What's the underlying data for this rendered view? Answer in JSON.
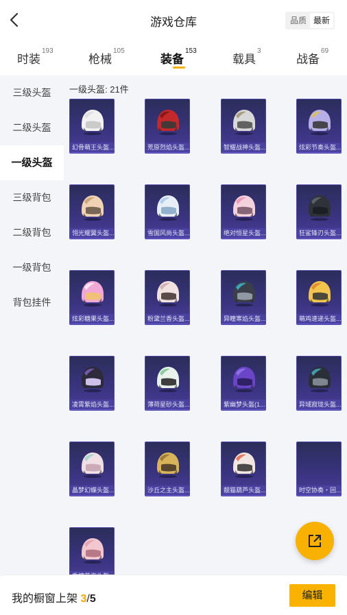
{
  "header": {
    "title": "游戏仓库",
    "sort_options": [
      "品质",
      "最新"
    ],
    "active_sort": 1
  },
  "tabs": [
    {
      "label": "时装",
      "count": "193"
    },
    {
      "label": "枪械",
      "count": "105"
    },
    {
      "label": "装备",
      "count": "153"
    },
    {
      "label": "载具",
      "count": "3"
    },
    {
      "label": "战备",
      "count": "69"
    }
  ],
  "active_tab": 2,
  "sidebar": {
    "items": [
      "三级头盔",
      "二级头盔",
      "一级头盔",
      "三级背包",
      "二级背包",
      "一级背包",
      "背包挂件"
    ],
    "active": 2
  },
  "section": {
    "title": "一级头盔: 21件"
  },
  "items": [
    {
      "name": "幻骨萌王头盔...",
      "base": "#f2f2f2",
      "accent": "#d9d9d9",
      "visor": "#c7c7c7"
    },
    {
      "name": "荒原烈焰头盔...",
      "base": "#c3292b",
      "accent": "#7a1212",
      "visor": "#3a3a3a"
    },
    {
      "name": "智耀战神头盔...",
      "base": "#d8d8d8",
      "accent": "#9a8a6a",
      "visor": "#555555"
    },
    {
      "name": "炫彩节奏头盔...",
      "base": "#b7b0e8",
      "accent": "#e0c341",
      "visor": "#3a3a3a"
    },
    {
      "name": "翎光耀翼头盔...",
      "base": "#f0d3b5",
      "accent": "#c19a6b",
      "visor": "#6b5a4a"
    },
    {
      "name": "雪国风尚头盔...",
      "base": "#e8eef5",
      "accent": "#9fc3e8",
      "visor": "#8aaac8"
    },
    {
      "name": "绝对恒星头盔...",
      "base": "#f3d1dd",
      "accent": "#e58bb0",
      "visor": "#7a5a6a"
    },
    {
      "name": "狂鲨锋刃头盔...",
      "base": "#2f3238",
      "accent": "#6a6f78",
      "visor": "#1b1d21"
    },
    {
      "name": "炫彩糖果头盔...",
      "base": "#f2a8d6",
      "accent": "#ffffff",
      "visor": "#f0c36b"
    },
    {
      "name": "粉黛兰香头盔...",
      "base": "#f1e1e1",
      "accent": "#c9a3a3",
      "visor": "#4a3a3a"
    },
    {
      "name": "异瞳寒焰头盔...",
      "base": "#3a3f4a",
      "accent": "#3ec7e0",
      "visor": "#9aa2ad"
    },
    {
      "name": "萌鸡速递头盔...",
      "base": "#f2c54d",
      "accent": "#e07a2a",
      "visor": "#3a3a3a"
    },
    {
      "name": "凌霄紫焰头盔...",
      "base": "#2d2a3a",
      "accent": "#8a6ad0",
      "visor": "#e0d0ff"
    },
    {
      "name": "薄荷星砂头盔...",
      "base": "#e9f2ea",
      "accent": "#6fbf8a",
      "visor": "#2a2a2a"
    },
    {
      "name": "紫幽梦头盔(1...",
      "base": "#6a45c7",
      "accent": "#9b7ff0",
      "visor": "#2a1c5a"
    },
    {
      "name": "异域寂珑头盔...",
      "base": "#2b3038",
      "accent": "#4ac1d6",
      "visor": "#8a9099"
    },
    {
      "name": "晶梦幻蝶头盔...",
      "base": "#f0dfe4",
      "accent": "#8fd5c8",
      "visor": "#c7a5b1"
    },
    {
      "name": "沙丘之主头盔...",
      "base": "#d9b35a",
      "accent": "#8a6a2a",
      "visor": "#4a3a2a"
    },
    {
      "name": "靓猫葫芦头盔...",
      "base": "#f1e6e0",
      "accent": "#e0573a",
      "visor": "#3a3a3a"
    },
    {
      "name": "时空协奏・回...",
      "base": "",
      "accent": "",
      "visor": ""
    },
    {
      "name": "香槟花海头盔...",
      "base": "#f3c7cf",
      "accent": "#e39aa8",
      "visor": "#b07080"
    }
  ],
  "footer": {
    "label": "我的橱窗上架 ",
    "current": "3",
    "separator": "/",
    "total": "5",
    "edit_label": "编辑"
  },
  "colors": {
    "accent": "#f9b200",
    "card_bg": "#3a3480",
    "card_label_bg": "#4a41a0"
  }
}
